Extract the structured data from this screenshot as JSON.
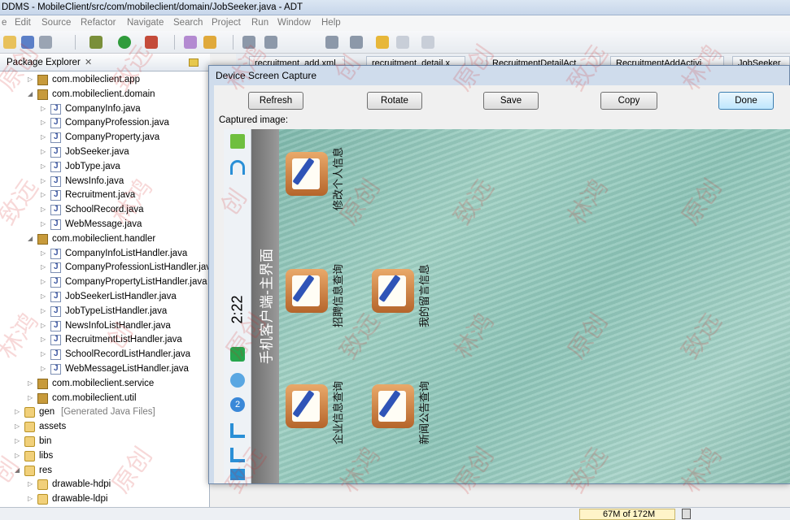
{
  "window": {
    "title": "DDMS - MobileClient/src/com/mobileclient/domain/JobSeeker.java - ADT"
  },
  "menu": [
    "e",
    "Edit",
    "Source",
    "Refactor",
    "Navigate",
    "Search",
    "Project",
    "Run",
    "Window",
    "Help"
  ],
  "explorer": {
    "title": "Package Explorer",
    "close": "✕",
    "items": [
      {
        "label": "com.mobileclient.app",
        "type": "package",
        "expanded": false,
        "depth": 1
      },
      {
        "label": "com.mobileclient.domain",
        "type": "package",
        "expanded": true,
        "depth": 1
      },
      {
        "label": "CompanyInfo.java",
        "type": "java",
        "depth": 2
      },
      {
        "label": "CompanyProfession.java",
        "type": "java",
        "depth": 2
      },
      {
        "label": "CompanyProperty.java",
        "type": "java",
        "depth": 2
      },
      {
        "label": "JobSeeker.java",
        "type": "java",
        "depth": 2
      },
      {
        "label": "JobType.java",
        "type": "java",
        "depth": 2
      },
      {
        "label": "NewsInfo.java",
        "type": "java",
        "depth": 2
      },
      {
        "label": "Recruitment.java",
        "type": "java",
        "depth": 2
      },
      {
        "label": "SchoolRecord.java",
        "type": "java",
        "depth": 2
      },
      {
        "label": "WebMessage.java",
        "type": "java",
        "depth": 2
      },
      {
        "label": "com.mobileclient.handler",
        "type": "package",
        "expanded": true,
        "depth": 1
      },
      {
        "label": "CompanyInfoListHandler.java",
        "type": "java",
        "depth": 2
      },
      {
        "label": "CompanyProfessionListHandler.java",
        "type": "java",
        "depth": 2
      },
      {
        "label": "CompanyPropertyListHandler.java",
        "type": "java",
        "depth": 2
      },
      {
        "label": "JobSeekerListHandler.java",
        "type": "java",
        "depth": 2
      },
      {
        "label": "JobTypeListHandler.java",
        "type": "java",
        "depth": 2
      },
      {
        "label": "NewsInfoListHandler.java",
        "type": "java",
        "depth": 2
      },
      {
        "label": "RecruitmentListHandler.java",
        "type": "java",
        "depth": 2
      },
      {
        "label": "SchoolRecordListHandler.java",
        "type": "java",
        "depth": 2
      },
      {
        "label": "WebMessageListHandler.java",
        "type": "java",
        "depth": 2
      },
      {
        "label": "com.mobileclient.service",
        "type": "package",
        "expanded": false,
        "depth": 1
      },
      {
        "label": "com.mobileclient.util",
        "type": "package",
        "expanded": false,
        "depth": 1
      },
      {
        "label": "gen",
        "suffix": "[Generated Java Files]",
        "type": "gen",
        "expanded": false,
        "depth": 0
      },
      {
        "label": "assets",
        "type": "folder",
        "expanded": false,
        "depth": 0
      },
      {
        "label": "bin",
        "type": "folder",
        "expanded": false,
        "depth": 0
      },
      {
        "label": "libs",
        "type": "folder",
        "expanded": false,
        "depth": 0
      },
      {
        "label": "res",
        "type": "folder",
        "expanded": true,
        "depth": 0
      },
      {
        "label": "drawable-hdpi",
        "type": "folder",
        "expanded": false,
        "depth": 1
      },
      {
        "label": "drawable-ldpi",
        "type": "folder",
        "expanded": false,
        "depth": 1
      }
    ]
  },
  "editor_tabs": [
    "recruitment_add.xml",
    "recruitment_detail.x",
    "RecruitmentDetailAct",
    "RecruitmentAddActivi",
    "JobSeeker"
  ],
  "dialog": {
    "title": "Device Screen Capture",
    "buttons": {
      "refresh": "Refresh",
      "rotate": "Rotate",
      "save": "Save",
      "copy": "Copy",
      "done": "Done"
    },
    "captured_label": "Captured image:"
  },
  "phone": {
    "clock": "2:22",
    "app_title": "手机客户端-主界面",
    "apps": [
      {
        "label": "修改个人信息"
      },
      {
        "label": "招聘信息查询"
      },
      {
        "label": "我的留言信息"
      },
      {
        "label": "企业信息查询"
      },
      {
        "label": "新闻公告查询"
      }
    ],
    "notification_badge": "2"
  },
  "status": {
    "heap": "67M of 172M"
  },
  "colors": {
    "accent": "#3c7fb1",
    "wallpaper": "#8ec2b5",
    "watermark": "#d22828"
  }
}
